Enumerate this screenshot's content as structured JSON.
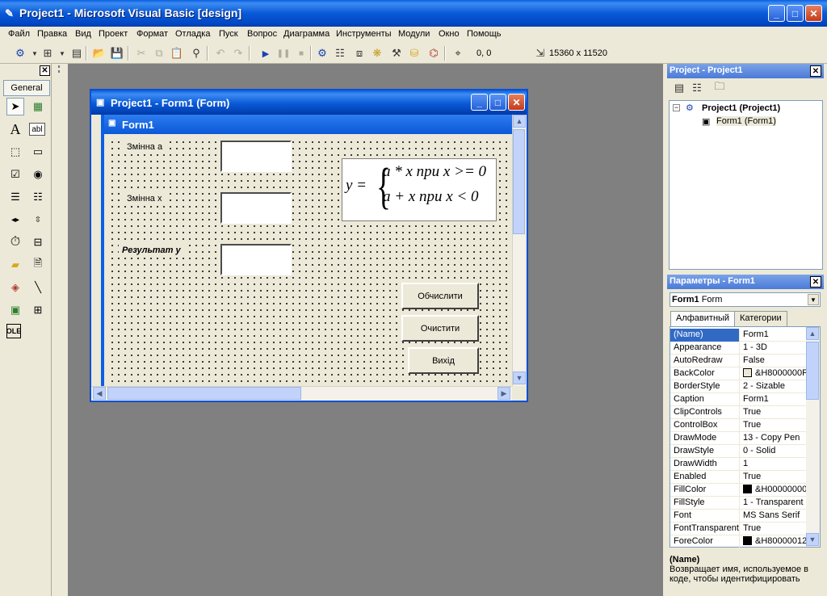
{
  "window": {
    "title": "Project1 - Microsoft Visual Basic [design]",
    "app_icon": "vb-icon"
  },
  "menu": [
    "Файл",
    "Правка",
    "Вид",
    "Проект",
    "Формат",
    "Отладка",
    "Пуск",
    "Вопрос",
    "Диаграмма",
    "Инструменты",
    "Модули",
    "Окно",
    "Помощь"
  ],
  "toolbar": {
    "position": "0, 0",
    "size": "15360 x 11520",
    "icons": [
      "add-project-icon",
      "add-form-icon",
      "menu-editor-icon",
      "open-icon",
      "save-icon",
      "cut-icon",
      "copy-icon",
      "paste-icon",
      "find-icon",
      "undo-icon",
      "redo-icon",
      "start-icon",
      "break-icon",
      "end-icon",
      "project-explorer-icon",
      "properties-window-icon",
      "form-layout-icon",
      "object-browser-icon",
      "toolbox-icon",
      "data-view-icon",
      "component-manager-icon"
    ]
  },
  "toolbox": {
    "tab_label": "General",
    "tools": [
      "pointer-icon",
      "picturebox-icon",
      "label-icon",
      "textbox-icon",
      "frame-icon",
      "commandbutton-icon",
      "checkbox-icon",
      "optionbutton-icon",
      "combobox-icon",
      "listbox-icon",
      "hscrollbar-icon",
      "vscrollbar-icon",
      "timer-icon",
      "drivelistbox-icon",
      "dirlistbox-icon",
      "filelistbox-icon",
      "shape-icon",
      "line-icon",
      "image-icon",
      "data-icon",
      "ole-icon"
    ]
  },
  "designer": {
    "title": "Project1 - Form1 (Form)",
    "form_caption": "Form1",
    "labels": {
      "var_a": "Змінна a",
      "var_x": "Змінна x",
      "result": "Результат y"
    },
    "formula": {
      "lhs": "y =",
      "row1": "a * x при x >= 0",
      "row2": "a + x при x < 0"
    },
    "buttons": {
      "calculate": "Обчислити",
      "clear": "Очистити",
      "exit": "Вихід"
    }
  },
  "project_panel": {
    "title": "Project - Project1",
    "tree": {
      "project": "Project1 (Project1)",
      "form": "Form1 (Form1)"
    }
  },
  "properties_panel": {
    "title": "Параметры - Form1",
    "object_name": "Form1",
    "object_type": "Form",
    "tabs": [
      "Алфавитный",
      "Категории"
    ],
    "rows": [
      {
        "name": "(Name)",
        "value": "Form1"
      },
      {
        "name": "Appearance",
        "value": "1 - 3D"
      },
      {
        "name": "AutoRedraw",
        "value": "False"
      },
      {
        "name": "BackColor",
        "value": "&H8000000F",
        "swatch": "#ece9d8"
      },
      {
        "name": "BorderStyle",
        "value": "2 - Sizable"
      },
      {
        "name": "Caption",
        "value": "Form1"
      },
      {
        "name": "ClipControls",
        "value": "True"
      },
      {
        "name": "ControlBox",
        "value": "True"
      },
      {
        "name": "DrawMode",
        "value": "13 - Copy Pen"
      },
      {
        "name": "DrawStyle",
        "value": "0 - Solid"
      },
      {
        "name": "DrawWidth",
        "value": "1"
      },
      {
        "name": "Enabled",
        "value": "True"
      },
      {
        "name": "FillColor",
        "value": "&H00000000",
        "swatch": "#000000"
      },
      {
        "name": "FillStyle",
        "value": "1 - Transparent"
      },
      {
        "name": "Font",
        "value": "MS Sans Serif"
      },
      {
        "name": "FontTransparent",
        "value": "True"
      },
      {
        "name": "ForeColor",
        "value": "&H80000012",
        "swatch": "#000000"
      }
    ],
    "description": {
      "name": "(Name)",
      "text": "Возвращает имя, используемое в коде, чтобы идентифицировать"
    }
  },
  "colors": {
    "titlebar": "#0a59d8",
    "selection": "#316ac5",
    "workspace": "#808080"
  }
}
